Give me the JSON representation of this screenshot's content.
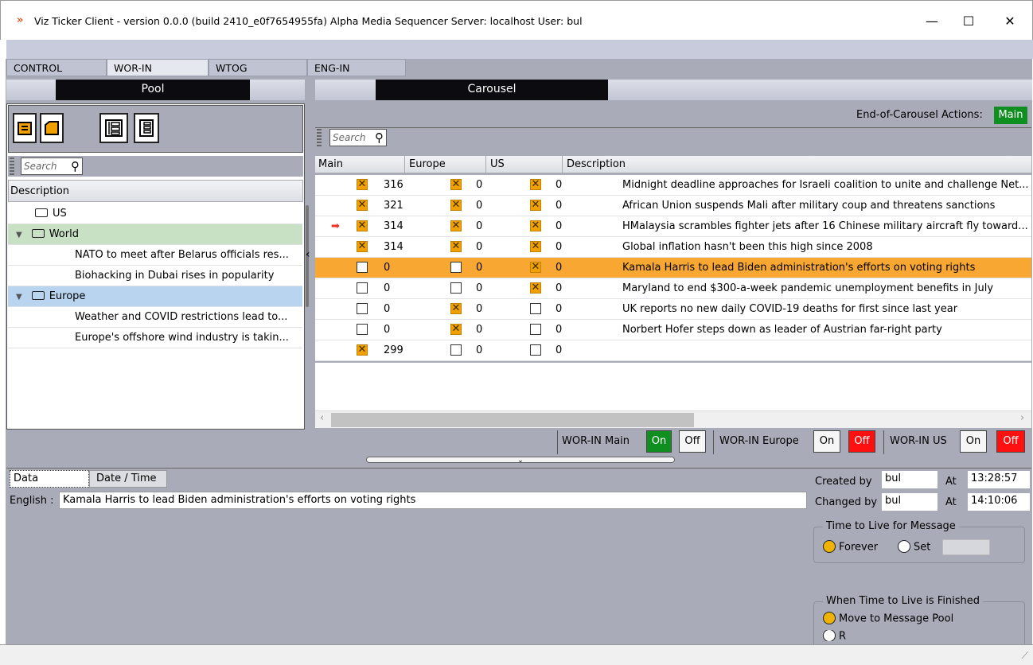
{
  "window": {
    "title": "Viz Ticker Client - version 0.0.0 (build 2410_e0f7654955fa) Alpha   Media Sequencer Server: localhost   User: bul",
    "minimize": "—",
    "maximize": "☐",
    "close": "✕"
  },
  "tabs": [
    "CONTROL",
    "WOR-IN",
    "WTOG",
    "ENG-IN"
  ],
  "pool": {
    "header": "Pool",
    "search_placeholder": "Search",
    "column_header": "Description",
    "tree": [
      {
        "label": "US",
        "level": 1,
        "expander": ""
      },
      {
        "label": "World",
        "level": 1,
        "expander": "▼"
      },
      {
        "label": "NATO to meet after Belarus officials res...",
        "level": 2
      },
      {
        "label": "Biohacking in Dubai rises in popularity",
        "level": 2
      },
      {
        "label": "Europe",
        "level": 1,
        "expander": "▼"
      },
      {
        "label": "Weather and COVID restrictions lead to...",
        "level": 2
      },
      {
        "label": "Europe's offshore wind industry is takin...",
        "level": 2
      }
    ],
    "collapse_arrow": "‹"
  },
  "carousel": {
    "header": "Carousel",
    "end_actions_label": "End-of-Carousel Actions:",
    "end_actions_value": "Main",
    "search_placeholder": "Search",
    "columns": [
      "Main",
      "Europe",
      "US",
      "Description"
    ],
    "rows": [
      {
        "arrow": "",
        "main_checked": true,
        "main": "316",
        "europe_checked": true,
        "europe": "0",
        "us_checked": true,
        "us": "0",
        "description": "Midnight deadline approaches for Israeli coalition to unite and challenge Net..."
      },
      {
        "arrow": "",
        "main_checked": true,
        "main": "321",
        "europe_checked": true,
        "europe": "0",
        "us_checked": true,
        "us": "0",
        "description": "African Union suspends Mali after military coup and threatens sanctions"
      },
      {
        "arrow": "➡",
        "main_checked": true,
        "main": "314",
        "europe_checked": true,
        "europe": "0",
        "us_checked": true,
        "us": "0",
        "description": "HMalaysia scrambles fighter jets after 16 Chinese military aircraft fly toward..."
      },
      {
        "arrow": "",
        "main_checked": true,
        "main": "314",
        "europe_checked": true,
        "europe": "0",
        "us_checked": true,
        "us": "0",
        "description": "Global inflation hasn't been this high since 2008"
      },
      {
        "arrow": "",
        "main_checked": false,
        "main": "0",
        "europe_checked": false,
        "europe": "0",
        "us_checked": true,
        "us": "0",
        "description": "Kamala Harris to lead Biden administration's efforts on voting rights",
        "selected": true
      },
      {
        "arrow": "",
        "main_checked": false,
        "main": "0",
        "europe_checked": false,
        "europe": "0",
        "us_checked": true,
        "us": "0",
        "description": "Maryland to end $300-a-week pandemic unemployment benefits in July"
      },
      {
        "arrow": "",
        "main_checked": false,
        "main": "0",
        "europe_checked": true,
        "europe": "0",
        "us_checked": false,
        "us": "0",
        "description": "UK reports no new daily COVID-19 deaths for first since last year"
      },
      {
        "arrow": "",
        "main_checked": false,
        "main": "0",
        "europe_checked": true,
        "europe": "0",
        "us_checked": false,
        "us": "0",
        "description": "Norbert Hofer steps down as leader of Austrian far-right party"
      },
      {
        "arrow": "",
        "main_checked": true,
        "main": "299",
        "europe_checked": false,
        "europe": "0",
        "us_checked": false,
        "us": "0",
        "description": ""
      }
    ]
  },
  "outputs": [
    {
      "label": "WOR-IN Main",
      "on": "On",
      "off": "Off",
      "state": "on"
    },
    {
      "label": "WOR-IN Europe",
      "on": "On",
      "off": "Off",
      "state": "off"
    },
    {
      "label": "WOR-IN US",
      "on": "On",
      "off": "Off",
      "state": "off"
    }
  ],
  "details": {
    "tabs": [
      "Data",
      "Date / Time"
    ],
    "english_label": "English :",
    "english_value": "Kamala Harris to lead Biden administration's efforts on voting rights",
    "created_by_label": "Created by",
    "created_by": "bul",
    "created_at_label": "At",
    "created_at": "13:28:57",
    "changed_by_label": "Changed by",
    "changed_by": "bul",
    "changed_at_label": "At",
    "changed_at": "14:10:06",
    "ttl_group": "Time to Live for Message",
    "ttl_forever": "Forever",
    "ttl_set": "Set",
    "finished_group": "When Time to Live is Finished",
    "finished_move": "Move to Message Pool",
    "finished_partial": "R"
  },
  "colors": {
    "accent": "#f8a832",
    "on_green": "#0f8f1f",
    "off_red": "#ff1010",
    "panel": "#a9abb8"
  }
}
